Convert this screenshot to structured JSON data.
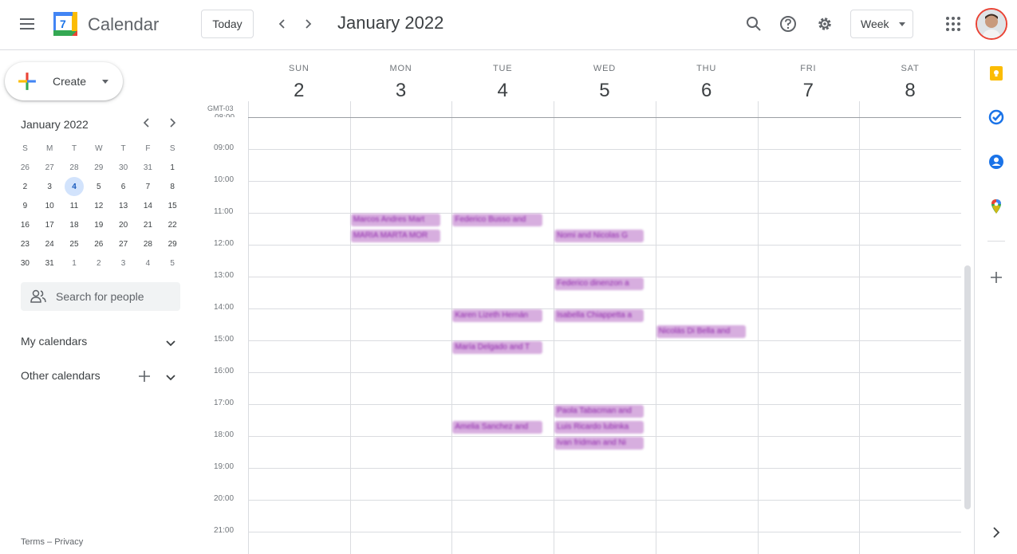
{
  "header": {
    "app_title": "Calendar",
    "logo_day": "7",
    "today_label": "Today",
    "month_title": "January 2022",
    "view_label": "Week",
    "icons": [
      "menu-icon",
      "search-icon",
      "help-icon",
      "settings-icon",
      "apps-icon"
    ]
  },
  "sidebar": {
    "create_label": "Create",
    "mini_calendar": {
      "title": "January 2022",
      "dow": [
        "S",
        "M",
        "T",
        "W",
        "T",
        "F",
        "S"
      ],
      "weeks": [
        [
          "26",
          "27",
          "28",
          "29",
          "30",
          "31",
          "1"
        ],
        [
          "2",
          "3",
          "4",
          "5",
          "6",
          "7",
          "8"
        ],
        [
          "9",
          "10",
          "11",
          "12",
          "13",
          "14",
          "15"
        ],
        [
          "16",
          "17",
          "18",
          "19",
          "20",
          "21",
          "22"
        ],
        [
          "23",
          "24",
          "25",
          "26",
          "27",
          "28",
          "29"
        ],
        [
          "30",
          "31",
          "1",
          "2",
          "3",
          "4",
          "5"
        ]
      ],
      "today": "4"
    },
    "search_placeholder": "Search for people",
    "my_calendars": "My calendars",
    "other_calendars": "Other calendars",
    "footer_terms": "Terms",
    "footer_sep": "–",
    "footer_privacy": "Privacy"
  },
  "week": {
    "timezone": "GMT-03",
    "days": [
      {
        "dow": "SUN",
        "date": "2"
      },
      {
        "dow": "MON",
        "date": "3"
      },
      {
        "dow": "TUE",
        "date": "4"
      },
      {
        "dow": "WED",
        "date": "5"
      },
      {
        "dow": "THU",
        "date": "6"
      },
      {
        "dow": "FRI",
        "date": "7"
      },
      {
        "dow": "SAT",
        "date": "8"
      }
    ],
    "hours": [
      "09:00",
      "10:00",
      "11:00",
      "12:00",
      "13:00",
      "14:00",
      "15:00",
      "16:00",
      "17:00",
      "18:00",
      "19:00",
      "20:00",
      "21:00"
    ],
    "events": [
      {
        "day": 1,
        "start": "11:00",
        "text": "Marcos Andres Mart"
      },
      {
        "day": 1,
        "start": "11:30",
        "text": "MARIA MARTA MOR"
      },
      {
        "day": 2,
        "start": "11:00",
        "text": "Federico Busso and"
      },
      {
        "day": 3,
        "start": "11:30",
        "text": "Nomi and Nicolas G"
      },
      {
        "day": 3,
        "start": "13:00",
        "text": "Federico dinenzon a"
      },
      {
        "day": 2,
        "start": "14:00",
        "text": "Karen Lizeth Hernán"
      },
      {
        "day": 3,
        "start": "14:00",
        "text": "Isabella Chiappetta a"
      },
      {
        "day": 4,
        "start": "14:30",
        "text": "Nicolás Di Bella and"
      },
      {
        "day": 2,
        "start": "15:00",
        "text": "María Delgado and T"
      },
      {
        "day": 3,
        "start": "17:00",
        "text": "Paola Tabacman and"
      },
      {
        "day": 2,
        "start": "17:30",
        "text": "Amelia Sanchez and"
      },
      {
        "day": 3,
        "start": "17:30",
        "text": "Luis Ricardo lubinka"
      },
      {
        "day": 3,
        "start": "18:00",
        "text": "Ivan fridman and Ni"
      }
    ],
    "event_color": "#d7aedf"
  }
}
